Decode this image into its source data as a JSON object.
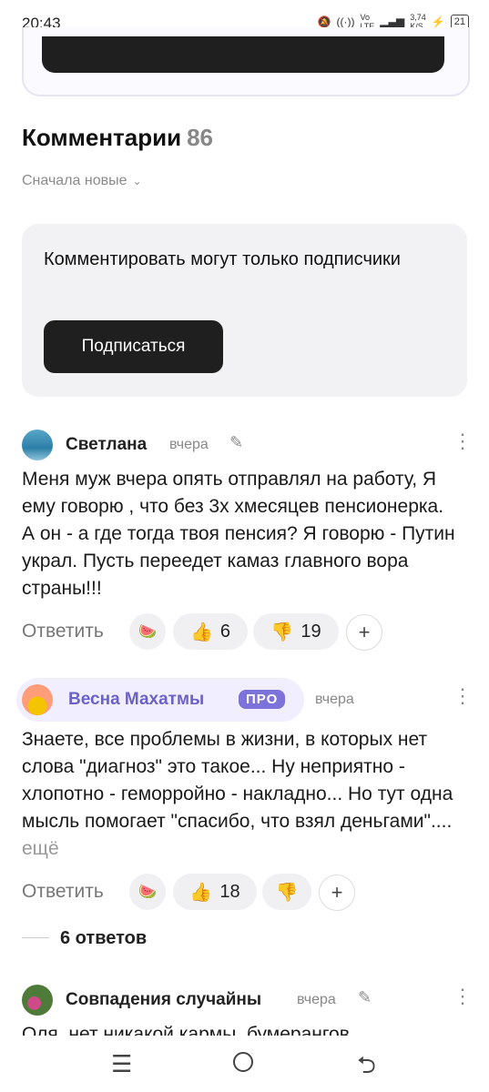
{
  "status_bar": {
    "time": "20:43",
    "net_speed": "3,74\nK/S",
    "battery": "21"
  },
  "comments": {
    "title": "Комментарии",
    "count": "86",
    "sort_label": "Сначала новые"
  },
  "subscribe_box": {
    "message": "Комментировать могут только подписчики",
    "button": "Подписаться"
  },
  "items": [
    {
      "author": "Светлана",
      "time": "вчера",
      "text": "Меня муж вчера опять отправлял на работу, Я ему говорю , что без 3х хмесяцев пенсионерка. А он - а где тогда твоя пенсия? Я говорю - Путин украл. Пусть переедет камаз главного вора страны!!!",
      "reply": "Ответить",
      "likes": "6",
      "dislikes": "19"
    },
    {
      "author": "Весна Махатмы",
      "badge": "ПРО",
      "time": "вчера",
      "text": "Знаете, все проблемы в жизни, в которых нет слова \"диагноз\" это такое... Ну неприятно - хлопотно - геморройно - накладно... Но тут одна мысль помогает \"спасибо, что взял деньгами\"....",
      "more": "ещё",
      "reply": "Ответить",
      "likes": "18",
      "replies": "6 ответов"
    },
    {
      "author": "Совпадения случайны",
      "time": "вчера",
      "text": "Оля, нет никакой кармы, бумерангов"
    }
  ],
  "colors": {
    "accent_dark": "#1f1f1f",
    "pro_purple": "#7d72d9",
    "pro_bg": "#f1efff"
  }
}
